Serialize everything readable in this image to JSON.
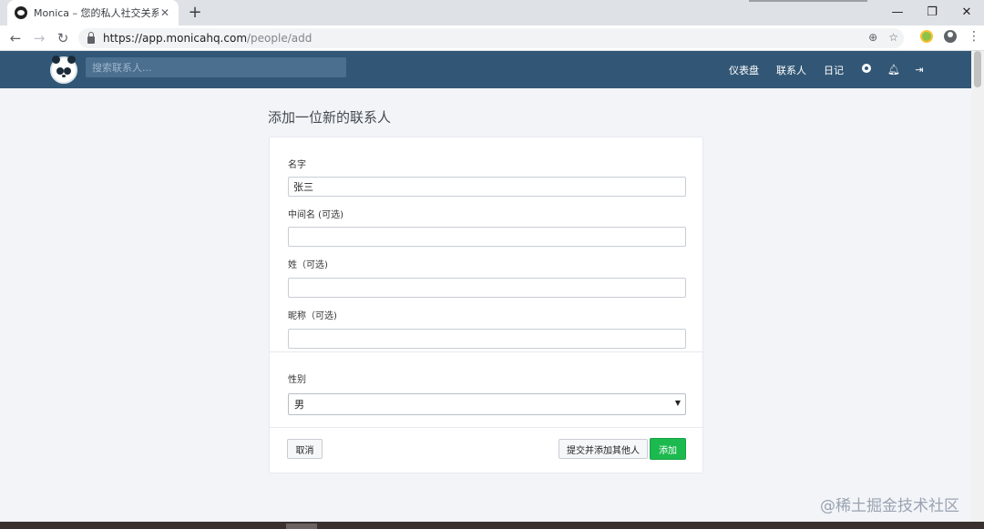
{
  "browser": {
    "tab_title": "Monica – 您的私人社交关系管",
    "url_host": "https://app.monicahq.com",
    "url_path": "/people/add"
  },
  "header": {
    "search_placeholder": "搜索联系人...",
    "nav": {
      "dashboard": "仪表盘",
      "contacts": "联系人",
      "journal": "日记"
    }
  },
  "page": {
    "title": "添加一位新的联系人"
  },
  "form": {
    "first_name_label": "名字",
    "first_name_value": "张三",
    "middle_name_label": "中间名 (可选)",
    "middle_name_value": "",
    "last_name_label": "姓（可选)",
    "last_name_value": "",
    "nickname_label": "昵称（可选)",
    "nickname_value": "",
    "gender_label": "性别",
    "gender_value": "男"
  },
  "buttons": {
    "cancel": "取消",
    "save_and_add": "提交并添加其他人",
    "add": "添加"
  },
  "watermark": "@稀土掘金技术社区",
  "colors": {
    "header_bg": "#325776",
    "add_button": "#1cb94f",
    "page_bg": "#f2f4f8"
  }
}
